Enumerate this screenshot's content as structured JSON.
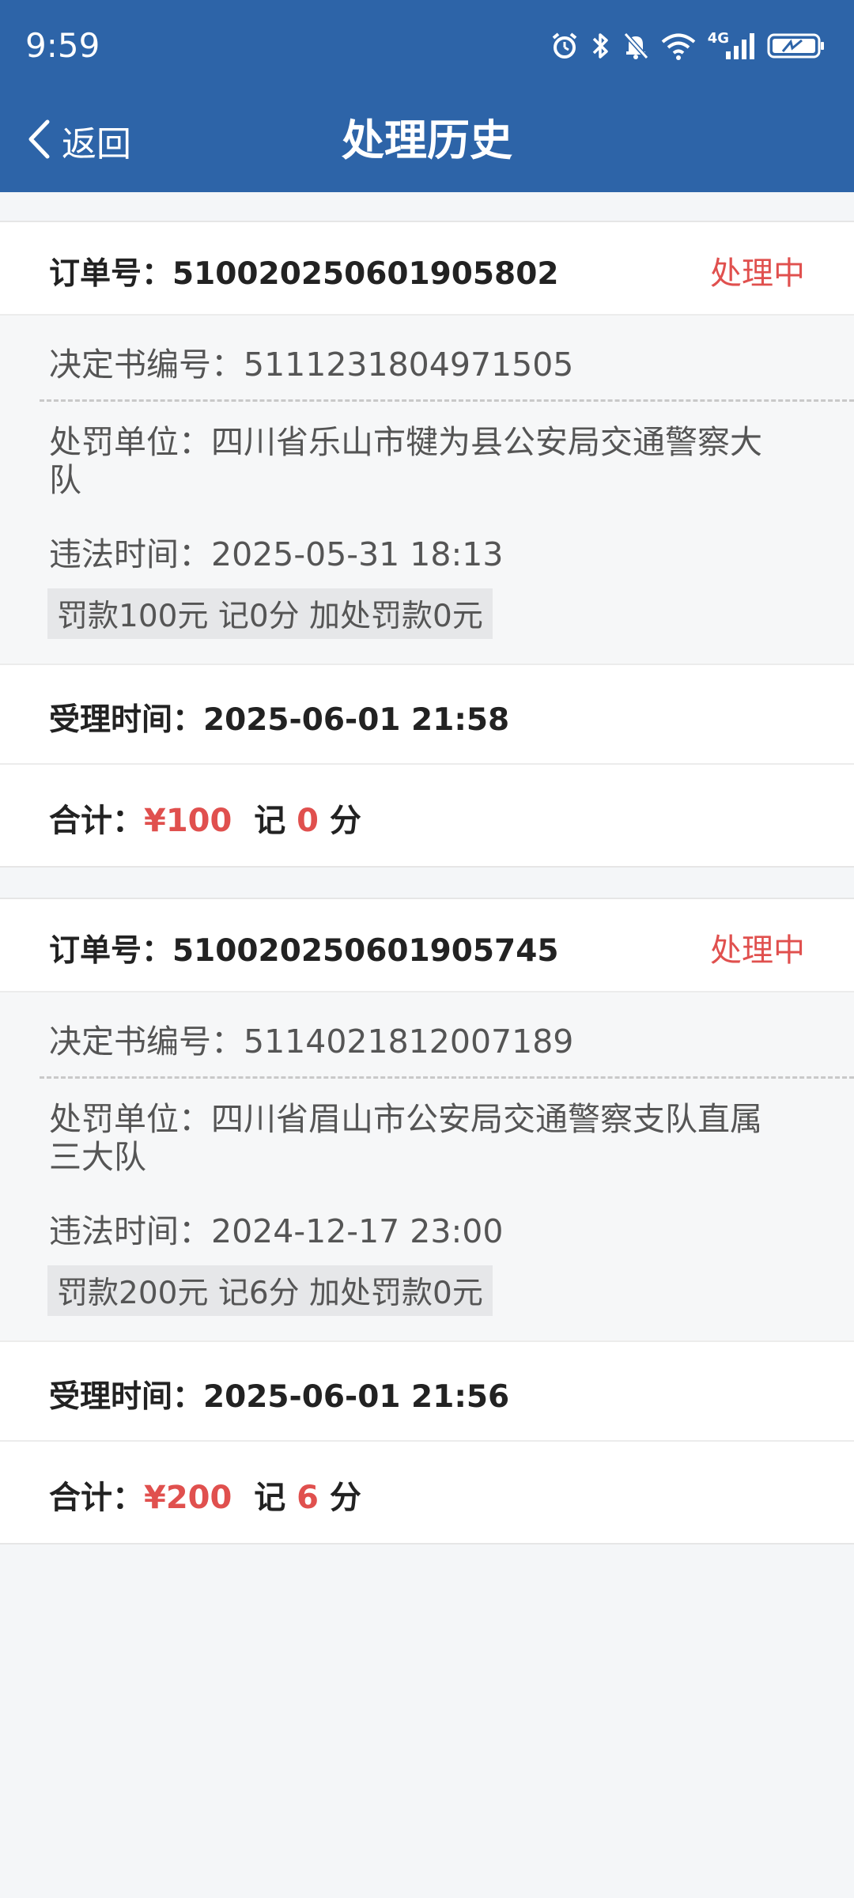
{
  "status_bar": {
    "time": "9:59",
    "network": "4G",
    "icons": [
      "alarm-icon",
      "bluetooth-icon",
      "bell-off-icon",
      "wifi-icon",
      "signal-icon",
      "battery-icon"
    ]
  },
  "header": {
    "back_label": "返回",
    "title": "处理历史",
    "background": "#2d64a8"
  },
  "colors": {
    "accent_red": "#e0504e",
    "text_dark": "#222222",
    "text_gray": "#555555"
  },
  "records": [
    {
      "order_label": "订单号：",
      "order_no": "510020250601905802",
      "status": "处理中",
      "decision_label": "决定书编号：",
      "decision_no": "5111231804971505",
      "unit_label": "处罚单位：",
      "unit": "四川省乐山市犍为县公安局交通警察大队",
      "violation_label": "违法时间：",
      "violation_time": "2025-05-31 18:13",
      "fine_tag": "罚款100元 记0分 加处罚款0元",
      "accept_label": "受理时间：",
      "accept_time": "2025-06-01 21:58",
      "total_label": "合计：",
      "total_amount": "¥100",
      "points_label": "记",
      "points": "0",
      "points_unit": "分"
    },
    {
      "order_label": "订单号：",
      "order_no": "510020250601905745",
      "status": "处理中",
      "decision_label": "决定书编号：",
      "decision_no": "5114021812007189",
      "unit_label": "处罚单位：",
      "unit": "四川省眉山市公安局交通警察支队直属三大队",
      "violation_label": "违法时间：",
      "violation_time": "2024-12-17 23:00",
      "fine_tag": "罚款200元 记6分 加处罚款0元",
      "accept_label": "受理时间：",
      "accept_time": "2025-06-01 21:56",
      "total_label": "合计：",
      "total_amount": "¥200",
      "points_label": "记",
      "points": "6",
      "points_unit": "分"
    }
  ]
}
